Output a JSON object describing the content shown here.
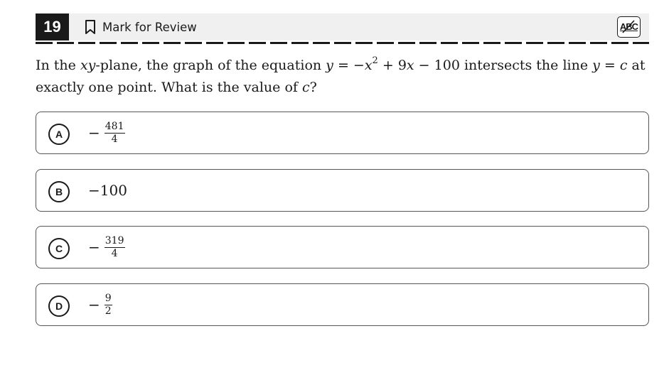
{
  "header": {
    "question_number": "19",
    "mark_for_review_label": "Mark for Review",
    "abc_label": "ABC"
  },
  "question": {
    "part1": "In the ",
    "xy": "xy",
    "part2": "-plane, the graph of the equation ",
    "eq_y": "y",
    "eq_equals": " = −",
    "eq_x": "x",
    "eq_exp": "2",
    "eq_plus": " + 9",
    "eq_x2": "x",
    "eq_rest": " − 100",
    "part3": " intersects the line ",
    "line_y": "y",
    "line_equals": " = ",
    "line_c": "c",
    "part4": " at exactly one point. What is the value of ",
    "c": "c",
    "part5": "?"
  },
  "options": [
    {
      "letter": "A",
      "sign": "−",
      "numerator": "481",
      "denominator": "4"
    },
    {
      "letter": "B",
      "text": "−100"
    },
    {
      "letter": "C",
      "sign": "−",
      "numerator": "319",
      "denominator": "4"
    },
    {
      "letter": "D",
      "sign": "−",
      "numerator": "9",
      "denominator": "2"
    }
  ]
}
